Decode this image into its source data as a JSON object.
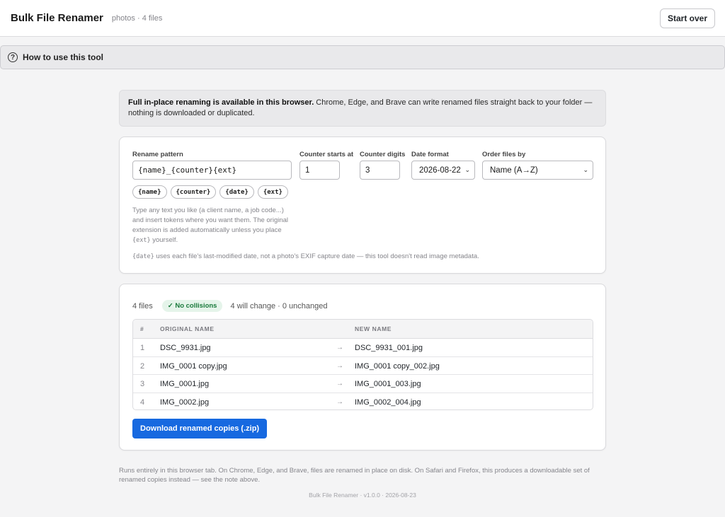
{
  "header": {
    "title": "Bulk File Renamer",
    "folder_info": "photos · 4 files",
    "start_over_label": "Start over"
  },
  "howto": {
    "label": "How to use this tool"
  },
  "notice": {
    "bold": "Full in-place renaming is available in this browser.",
    "text": " Chrome, Edge, and Brave can write renamed files straight back to your folder — nothing is downloaded or duplicated."
  },
  "settings": {
    "pattern_label": "Rename pattern",
    "pattern_value": "{name}_{counter}{ext}",
    "counter_start_label": "Counter starts at",
    "counter_start_value": "1",
    "counter_digits_label": "Counter digits",
    "counter_digits_value": "3",
    "date_format_label": "Date format",
    "date_format_value": "2026-08-22",
    "order_label": "Order files by",
    "order_value": "Name (A→Z)",
    "tokens": [
      "{name}",
      "{counter}",
      "{date}",
      "{ext}"
    ],
    "help_text_1": "Type any text you like (a client name, a job code...) and insert tokens where you want them. The original extension is added automatically unless you place ",
    "help_ext_code": "{ext}",
    "help_text_2": " yourself.",
    "date_note_code": "{date}",
    "date_note_text": " uses each file's last-modified date, not a photo's EXIF capture date — this tool doesn't read image metadata."
  },
  "results": {
    "file_count": "4 files",
    "collision_badge": "✓ No collisions",
    "change_summary": "4 will change · 0 unchanged",
    "columns": {
      "index": "#",
      "original": "ORIGINAL NAME",
      "new": "NEW NAME"
    },
    "rows": [
      {
        "index": "1",
        "original": "DSC_9931.jpg",
        "arrow": "→",
        "new": "DSC_9931_001.jpg"
      },
      {
        "index": "2",
        "original": "IMG_0001 copy.jpg",
        "arrow": "→",
        "new": "IMG_0001 copy_002.jpg"
      },
      {
        "index": "3",
        "original": "IMG_0001.jpg",
        "arrow": "→",
        "new": "IMG_0001_003.jpg"
      },
      {
        "index": "4",
        "original": "IMG_0002.jpg",
        "arrow": "→",
        "new": "IMG_0002_004.jpg"
      }
    ],
    "download_label": "Download renamed copies (.zip)"
  },
  "footer": {
    "note": "Runs entirely in this browser tab. On Chrome, Edge, and Brave, files are renamed in place on disk. On Safari and Firefox, this produces a downloadable set of renamed copies instead — see the note above.",
    "version": "Bulk File Renamer · v1.0.0 · 2026-08-23"
  },
  "colors": {
    "accent": "#1769e0",
    "success": "#1a7a3c",
    "success_bg": "#e5f4ea"
  },
  "icons": {
    "help": "question-circle-icon",
    "arrow": "arrow-right-icon",
    "dropdown": "chevron-down-icon"
  }
}
